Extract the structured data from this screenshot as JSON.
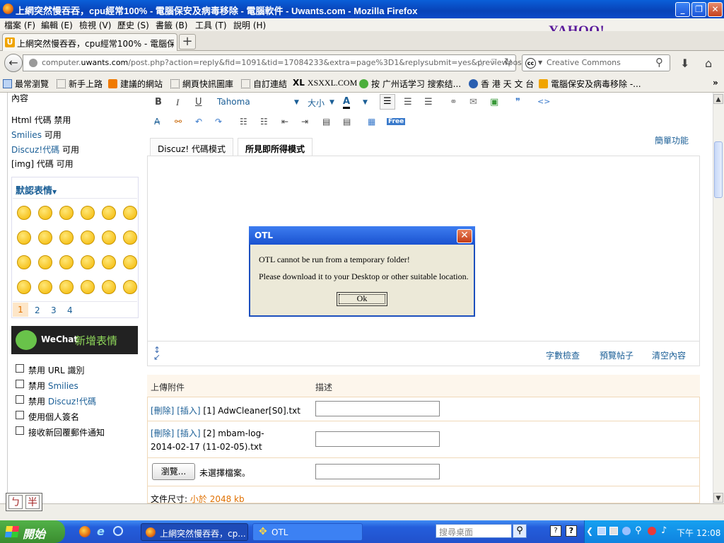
{
  "window": {
    "title": "上網突然慢吞吞，cpu經常100% - 電腦保安及病毒移除 - 電腦軟件 - Uwants.com - Mozilla Firefox",
    "minimize": "_",
    "restore": "❐",
    "close": "✕"
  },
  "menu": [
    "檔案 (F)",
    "編輯 (E)",
    "檢視 (V)",
    "歷史 (S)",
    "書籤 (B)",
    "工具 (T)",
    "說明 (H)"
  ],
  "yahoo_logo": "YAHOO!",
  "tab": {
    "label": "上網突然慢吞吞，cpu經常100% - 電腦保...",
    "icon": "U",
    "new_tab": "+"
  },
  "nav": {
    "url_prefix": "computer.",
    "url_domain": "uwants.com",
    "url_rest": "/post.php?action=reply&fid=1091&tid=17084233&extra=page%3D1&replysubmit=yes&previewpost=yes",
    "search_placeholder": "Creative Commons",
    "search_engine_icon": "cc"
  },
  "bookmarks": [
    "最常瀏覽",
    "新手上路",
    "建議的網站",
    "網頁快訊圖庫",
    "自訂連結",
    "XSXXL.COM",
    "按 广州话学习 搜索结...",
    "香 港 天 文 台",
    "電腦保安及病毒移除 -..."
  ],
  "bookmark_xl": "XL",
  "left": {
    "content_label": "內容",
    "html_prefix": "Html 代碼",
    "html_state": "禁用",
    "smilies_prefix": "Smilies",
    "smilies_state": "可用",
    "discuz_prefix": "Discuz!代碼",
    "discuz_state": "可用",
    "img_prefix": "[img] 代碼",
    "img_state": "可用",
    "emoticon_header": "默認表情",
    "pages": [
      "1",
      "2",
      "3",
      "4"
    ],
    "wechat_brand": "WeChat",
    "wechat_promo": "新增表情",
    "options": [
      {
        "prefix": "禁用",
        "label": "URL 識別"
      },
      {
        "prefix": "禁用",
        "label": "Smilies"
      },
      {
        "prefix": "禁用",
        "label": "Discuz!代碼"
      },
      {
        "prefix": "",
        "label": "使用個人簽名"
      },
      {
        "prefix": "",
        "label": "接收新回覆郵件通知"
      }
    ]
  },
  "editor": {
    "font_name": "Tahoma",
    "font_size": "大小",
    "bold": "B",
    "italic": "I",
    "underline": "U",
    "mode_discuz": "Discuz! 代碼模式",
    "mode_wysiwyg": "所見即所得模式",
    "simple_mode": "簡單功能",
    "footer_word_count": "字數檢查",
    "footer_preview": "預覽帖子",
    "footer_clear": "清空內容",
    "free_label": "Free"
  },
  "attachments": {
    "col_upload": "上傳附件",
    "col_desc": "描述",
    "delete_label": "[刪除]",
    "insert_label": "[插入]",
    "rows": [
      {
        "index": "[1]",
        "name": "AdwCleaner[S0].txt"
      },
      {
        "index": "[2]",
        "name": "mbam-log-",
        "name2": "2014-02-17 (11-02-05).txt"
      }
    ],
    "browse_label": "瀏覽...",
    "no_file": "未選擇檔案。",
    "filesize_label": "文件尺寸:",
    "filesize_value": "小於 2048 kb"
  },
  "dialog": {
    "title": "OTL",
    "line1": "OTL cannot be run from a temporary folder!",
    "line2": "Please download it to your Desktop or other suitable location.",
    "ok": "Ok",
    "close": "✕"
  },
  "ime": {
    "a": "ㄅ",
    "b": "半"
  },
  "taskbar": {
    "start": "開始",
    "task1": "上網突然慢吞吞，cp...",
    "task2": "OTL",
    "desk_search": "搜尋桌面",
    "clock": "下午 12:08"
  }
}
